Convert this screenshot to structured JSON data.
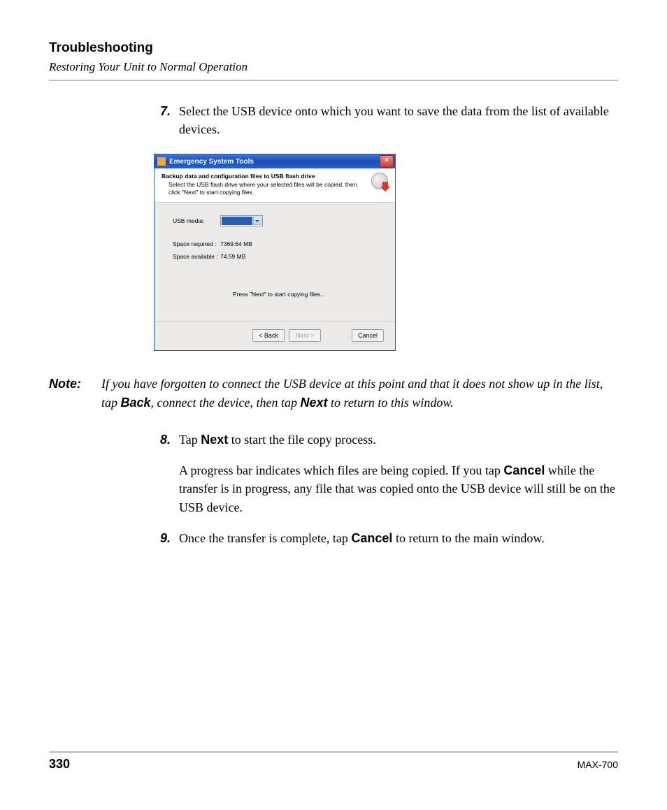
{
  "header": {
    "section": "Troubleshooting",
    "subtitle": "Restoring Your Unit to Normal Operation"
  },
  "steps": {
    "s7": {
      "num": "7.",
      "text": "Select the USB device onto which you want to save the data from the list of available devices."
    },
    "s8": {
      "num": "8.",
      "t1a": "Tap ",
      "t1b": "Next",
      "t1c": " to start the file copy process.",
      "t2a": "A progress bar indicates which files are being copied. If you tap ",
      "t2b": "Cancel",
      "t2c": " while the transfer is in progress, any file that was copied onto the USB device will still be on the USB device."
    },
    "s9": {
      "num": "9.",
      "t1a": "Once the transfer is complete, tap ",
      "t1b": "Cancel",
      "t1c": " to return to the main window."
    }
  },
  "note": {
    "label": "Note:",
    "p1": "If you have forgotten to connect the USB device at this point and that it does not show up in the list, tap ",
    "b1": "Back",
    "p2": ", connect the device, then tap ",
    "b2": "Next",
    "p3": " to return to this window."
  },
  "dialog": {
    "title": "Emergency System Tools",
    "close_glyph": "×",
    "heading": "Backup data and configuration files to USB flash drive",
    "description": "Select the USB flash drive where your selected files will be copied, then click \"Next\" to start copying files.",
    "usb_label": "USB media:",
    "space_required_label": "Space required :",
    "space_required_value": "7369.64 MB",
    "space_available_label": "Space available :",
    "space_available_value": "74.59 MB",
    "hint": "Press \"Next\" to start copying files...",
    "buttons": {
      "back": "< Back",
      "next": "Next >",
      "cancel": "Cancel"
    }
  },
  "footer": {
    "page": "330",
    "model": "MAX-700"
  }
}
